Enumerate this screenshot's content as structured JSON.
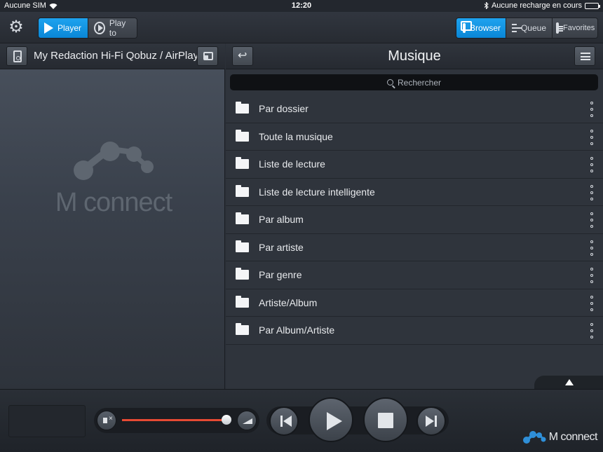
{
  "status": {
    "carrier": "Aucune SIM",
    "time": "12:20",
    "charging": "Aucune recharge en cours"
  },
  "toolbar": {
    "player_label": "Player",
    "playto_label": "Play to",
    "browser_label": "Browser",
    "queue_label": "Queue",
    "favorites_label": "Favorites"
  },
  "zone": {
    "title": "My Redaction Hi-Fi Qobuz / AirPlay"
  },
  "logo": {
    "text": "M connect"
  },
  "browse": {
    "title": "Musique",
    "search_placeholder": "Rechercher",
    "items": [
      {
        "label": "Par dossier"
      },
      {
        "label": "Toute la musique"
      },
      {
        "label": "Liste de lecture"
      },
      {
        "label": "Liste de lecture intelligente"
      },
      {
        "label": "Par album"
      },
      {
        "label": "Par artiste"
      },
      {
        "label": "Par genre"
      },
      {
        "label": "Artiste/Album"
      },
      {
        "label": "Par Album/Artiste"
      }
    ]
  },
  "player": {
    "volume_percent": 97,
    "brand": "M connect"
  },
  "colors": {
    "accent": "#0a95e6",
    "volume_fill": "#e64a33",
    "brand_blue": "#2f8fd8"
  }
}
